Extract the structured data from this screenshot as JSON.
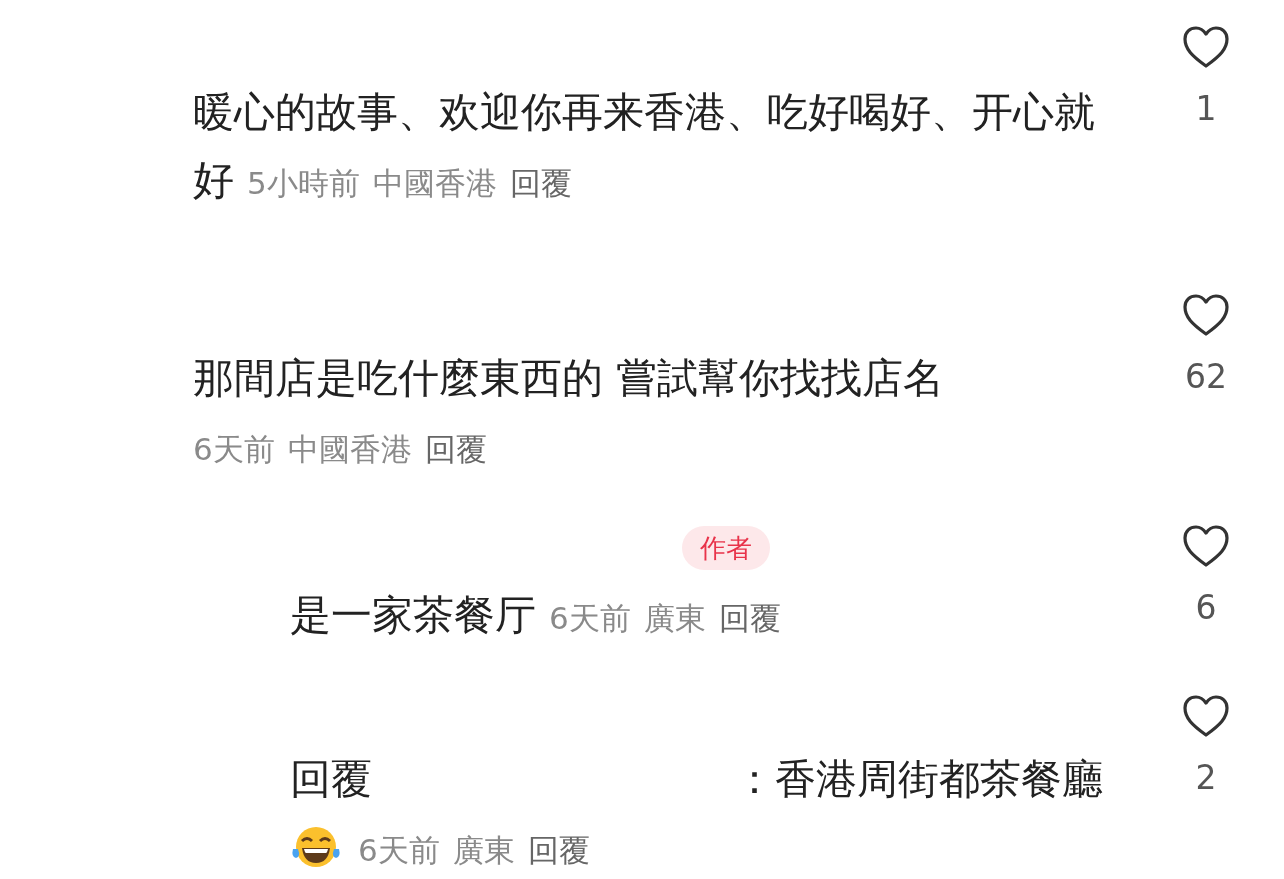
{
  "comments": [
    {
      "kind": "comment",
      "text_lines": [
        "暖心的故事、欢迎你再来香港、吃好喝好、开心就",
        "好"
      ],
      "has_emoji": false,
      "time": "5小時前",
      "location": "中國香港",
      "reply": "回覆",
      "liked": false,
      "likes": "1"
    },
    {
      "kind": "comment",
      "text_lines": [
        "那間店是吃什麼東西的 嘗試幫你找找店名"
      ],
      "has_emoji": false,
      "time": "6天前",
      "location": "中國香港",
      "reply": "回覆",
      "liked": false,
      "likes": "62"
    },
    {
      "kind": "reply",
      "author_badge": "作者",
      "text_lines": [
        "是一家茶餐厅"
      ],
      "has_emoji": false,
      "time": "6天前",
      "location": "廣東",
      "reply": "回覆",
      "liked": false,
      "likes": "6"
    },
    {
      "kind": "reply",
      "mention_label": "回覆",
      "text_lines": [
        "：香港周街都茶餐廳"
      ],
      "has_emoji": true,
      "time": "6天前",
      "location": "廣東",
      "reply": "回覆",
      "liked": false,
      "likes": "2"
    }
  ]
}
